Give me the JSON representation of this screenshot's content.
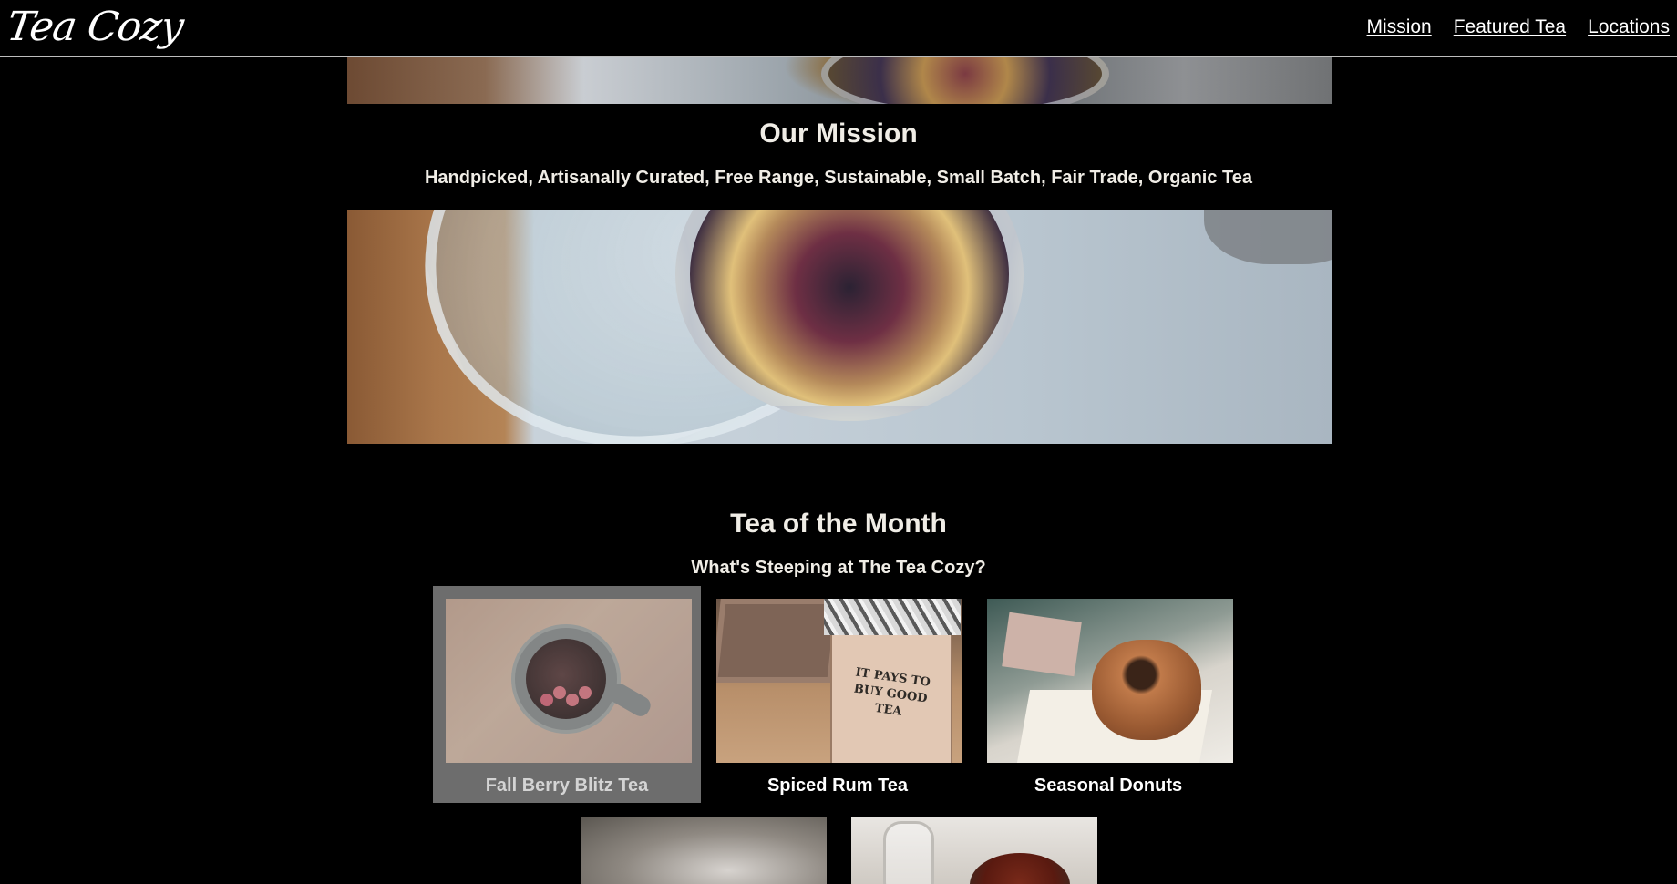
{
  "header": {
    "logo": "Tea Cozy",
    "nav": [
      "Mission",
      "Featured Tea",
      "Locations"
    ]
  },
  "mission": {
    "title": "Our Mission",
    "subtitle": "Handpicked, Artisanally Curated, Free Range, Sustainable, Small Batch, Fair Trade, Organic Tea"
  },
  "tea_of_month": {
    "title": "Tea of the Month",
    "subtitle": "What's Steeping at The Tea Cozy?",
    "items": [
      {
        "label": "Fall Berry Blitz Tea"
      },
      {
        "label": "Spiced Rum Tea"
      },
      {
        "label": "Seasonal Donuts"
      }
    ]
  },
  "box_text": "IT PAYS TO BUY GOOD TEA"
}
